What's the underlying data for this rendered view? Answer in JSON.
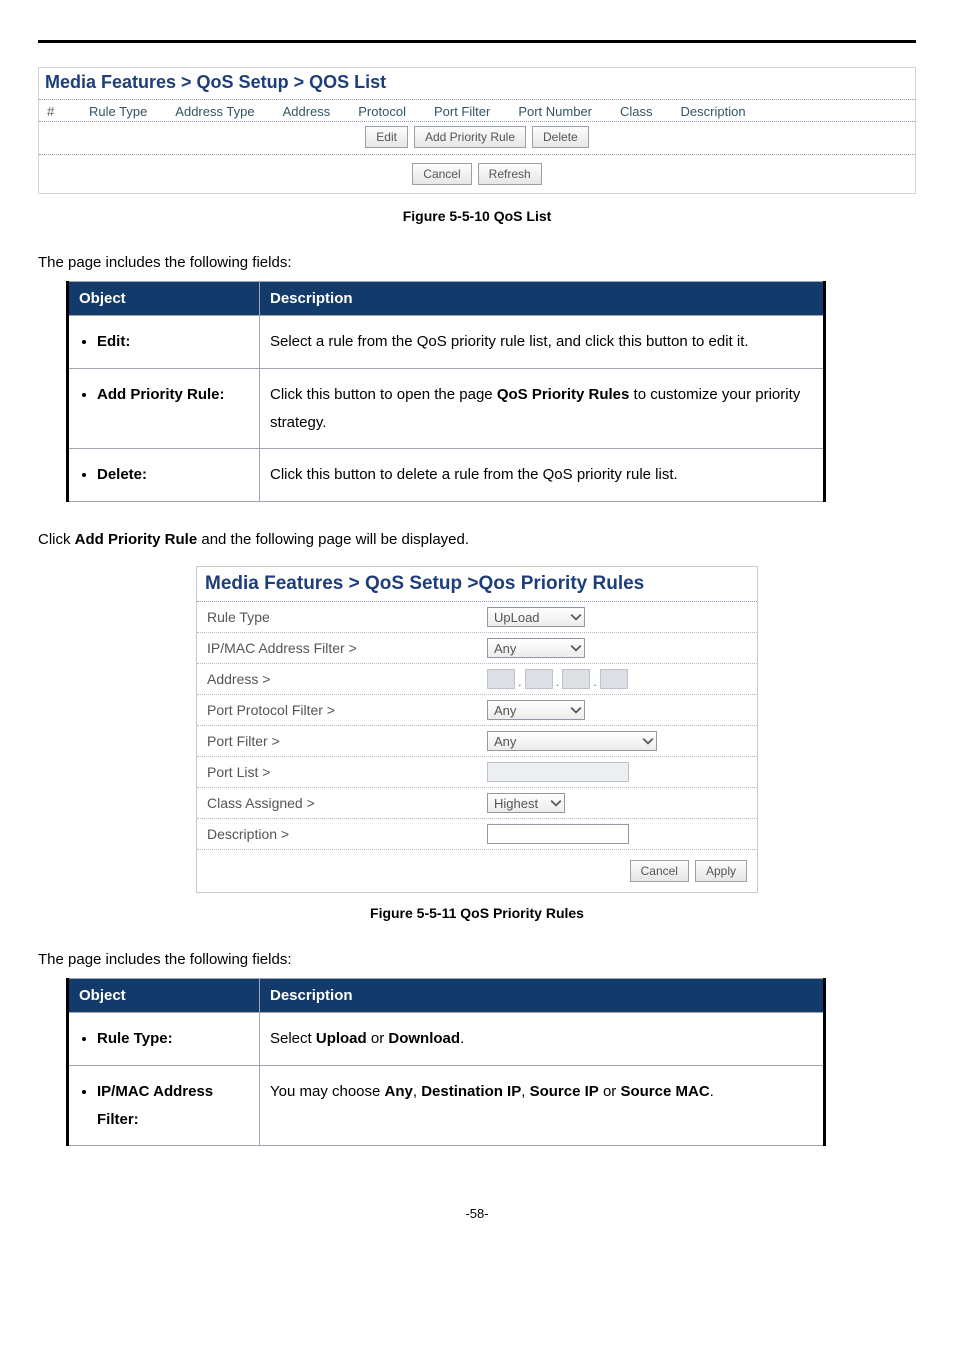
{
  "scr1": {
    "crumb": "Media Features > QoS Setup > QOS List",
    "cols": [
      "#",
      "Rule Type",
      "Address Type",
      "Address",
      "Protocol",
      "Port Filter",
      "Port Number",
      "Class",
      "Description"
    ],
    "btns1": [
      "Edit",
      "Add Priority Rule",
      "Delete"
    ],
    "btns2": [
      "Cancel",
      "Refresh"
    ]
  },
  "fig1": "Figure 5-5-10 QoS List",
  "intro1": "The page includes the following fields:",
  "tbl1": {
    "h1": "Object",
    "h2": "Description",
    "rows": [
      {
        "obj": "Edit:",
        "desc": "Select a rule from the QoS priority rule list, and click this button to edit it."
      },
      {
        "obj": "Add Priority Rule:",
        "desc_pre": "Click this button to open the page ",
        "desc_bold": "QoS Priority Rules",
        "desc_post": " to customize your priority strategy."
      },
      {
        "obj": "Delete:",
        "desc": "Click this button to delete a rule from the QoS priority rule list."
      }
    ]
  },
  "para1_pre": "Click ",
  "para1_bold": "Add Priority Rule",
  "para1_post": " and the following page will be displayed.",
  "scr2": {
    "crumb": "Media Features > QoS Setup >Qos Priority Rules",
    "rows": [
      {
        "lab": "Rule Type",
        "type": "select",
        "val": "UpLoad",
        "cls": "md"
      },
      {
        "lab": "IP/MAC Address Filter >",
        "type": "select",
        "val": "Any",
        "cls": "md"
      },
      {
        "lab": "Address >",
        "type": "ip"
      },
      {
        "lab": "Port Protocol Filter >",
        "type": "select",
        "val": "Any",
        "cls": "md"
      },
      {
        "lab": "Port Filter >",
        "type": "select",
        "val": "Any",
        "cls": "lg"
      },
      {
        "lab": "Port List >",
        "type": "text-grey"
      },
      {
        "lab": "Class Assigned >",
        "type": "select",
        "val": "Highest",
        "cls": "sm"
      },
      {
        "lab": "Description >",
        "type": "text-white"
      }
    ],
    "btns": [
      "Cancel",
      "Apply"
    ]
  },
  "fig2": "Figure 5-5-11 QoS Priority Rules",
  "intro2": "The page includes the following fields:",
  "tbl2": {
    "h1": "Object",
    "h2": "Description",
    "rows": [
      {
        "obj": "Rule Type:",
        "desc_pre": "Select ",
        "b1": "Upload",
        "mid": " or ",
        "b2": "Download",
        "post": "."
      },
      {
        "obj": "IP/MAC Address Filter:",
        "desc_pre": "You may choose ",
        "b1": "Any",
        "c1": ", ",
        "b2": "Destination IP",
        "c2": ", ",
        "b3": "Source IP",
        "c3": " or ",
        "b4": "Source MAC",
        "post": "."
      }
    ]
  },
  "page_num": "-58-",
  "chart_data": null
}
